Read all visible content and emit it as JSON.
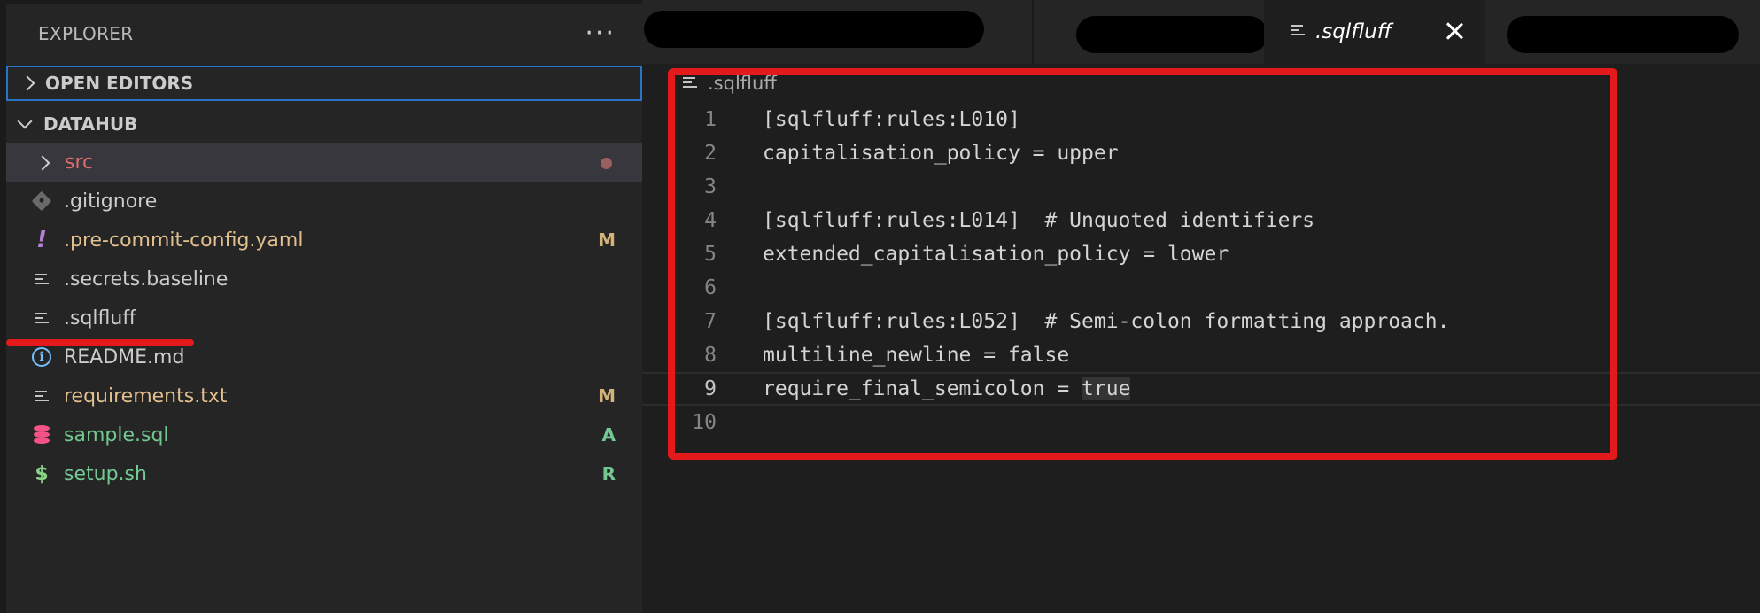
{
  "sidebar": {
    "title": "EXPLORER",
    "more_icon": "ellipsis-icon",
    "open_editors_label": "OPEN EDITORS",
    "workspace_label": "DATAHUB",
    "files": [
      {
        "name": "src",
        "type": "folder",
        "status": "modified-dot"
      },
      {
        "name": ".gitignore",
        "icon": "git-icon",
        "badge": ""
      },
      {
        "name": ".pre-commit-config.yaml",
        "icon": "exclamation-icon",
        "badge": "M"
      },
      {
        "name": ".secrets.baseline",
        "icon": "lines-icon",
        "badge": ""
      },
      {
        "name": ".sqlfluff",
        "icon": "lines-icon",
        "badge": ""
      },
      {
        "name": "README.md",
        "icon": "info-icon",
        "badge": ""
      },
      {
        "name": "requirements.txt",
        "icon": "lines-icon",
        "badge": "M"
      },
      {
        "name": "sample.sql",
        "icon": "database-icon",
        "badge": "A"
      },
      {
        "name": "setup.sh",
        "icon": "dollar-icon",
        "badge": "R"
      }
    ]
  },
  "tabs": {
    "active_label": ".sqlfluff",
    "close_icon": "close-icon"
  },
  "editor": {
    "breadcrumb": ".sqlfluff",
    "lines": [
      {
        "num": "1",
        "text": "[sqlfluff:rules:L010]"
      },
      {
        "num": "2",
        "text": "capitalisation_policy = upper"
      },
      {
        "num": "3",
        "text": ""
      },
      {
        "num": "4",
        "text": "[sqlfluff:rules:L014]  # Unquoted identifiers"
      },
      {
        "num": "5",
        "text": "extended_capitalisation_policy = lower"
      },
      {
        "num": "6",
        "text": ""
      },
      {
        "num": "7",
        "text": "[sqlfluff:rules:L052]  # Semi-colon formatting approach."
      },
      {
        "num": "8",
        "text": "multiline_newline = false"
      },
      {
        "num": "9",
        "text_before": "require_final_semicolon = ",
        "text_hl": "true"
      },
      {
        "num": "10",
        "text": ""
      }
    ]
  },
  "colors": {
    "annotation_red": "#e3191b",
    "focus_blue": "#2a74c8",
    "modified_yellow": "#e2c08d",
    "added_green": "#73c991",
    "error_red": "#e06c6c"
  }
}
